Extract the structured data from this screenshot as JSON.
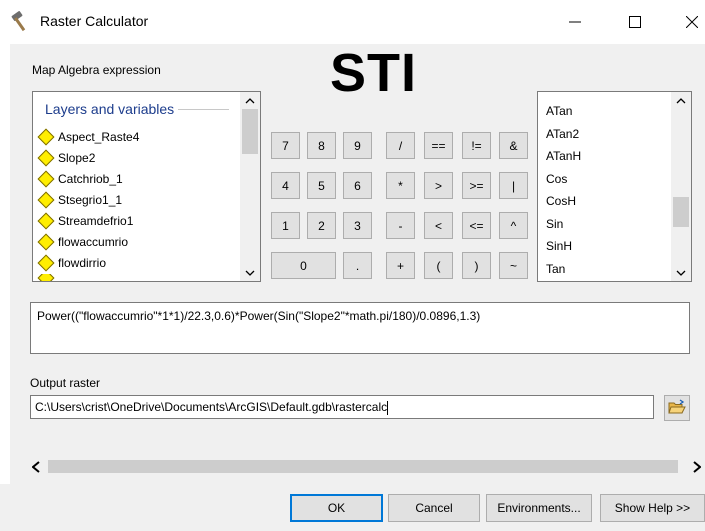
{
  "window": {
    "title": "Raster Calculator"
  },
  "labels": {
    "map_algebra": "Map Algebra expression",
    "output_raster": "Output raster",
    "overlay_text": "STI"
  },
  "layers": {
    "title": "Layers and variables",
    "items": [
      "Aspect_Raste4",
      "Slope2",
      "Catchriob_1",
      "Stsegrio1_1",
      "Streamdefrio1",
      "flowaccumrio",
      "flowdirrio"
    ],
    "scroll_fraction": 0.0
  },
  "calculator": {
    "rows": [
      [
        "7",
        "8",
        "9",
        "/",
        "==",
        "!=",
        "&"
      ],
      [
        "4",
        "5",
        "6",
        "*",
        ">",
        ">=",
        "|"
      ],
      [
        "1",
        "2",
        "3",
        "-",
        "<",
        "<=",
        "^"
      ],
      [
        "0",
        ".",
        "+",
        "(",
        ")",
        "~"
      ]
    ]
  },
  "functions": {
    "items": [
      "ATan",
      "ATan2",
      "ATanH",
      "Cos",
      "CosH",
      "Sin",
      "SinH",
      "Tan"
    ],
    "scroll_fraction": 0.7
  },
  "expression": "Power((\"flowaccumrio\"*1*1)/22.3,0.6)*Power(Sin(\"Slope2\"*math.pi/180)/0.0896,1.3)",
  "output_raster": "C:\\Users\\crist\\OneDrive\\Documents\\ArcGIS\\Default.gdb\\rastercalc",
  "buttons": {
    "ok": "OK",
    "cancel": "Cancel",
    "environments": "Environments...",
    "show_help": "Show Help >>"
  },
  "icons": {
    "app": "hammer-icon",
    "folder": "open-folder-icon"
  }
}
